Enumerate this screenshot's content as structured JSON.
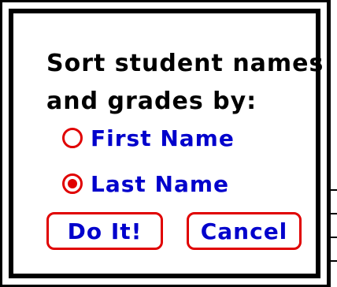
{
  "dialog": {
    "prompt_line1": "Sort student names",
    "prompt_line2": "and grades by:",
    "options": [
      {
        "label": "First Name",
        "selected": false
      },
      {
        "label": "Last Name",
        "selected": true
      }
    ],
    "buttons": {
      "ok_label": "Do It!",
      "cancel_label": "Cancel"
    }
  },
  "colors": {
    "accent": "#e00000",
    "label_text": "#0000cc",
    "prompt_text": "#000000",
    "background_highlight": "#ffee00"
  }
}
